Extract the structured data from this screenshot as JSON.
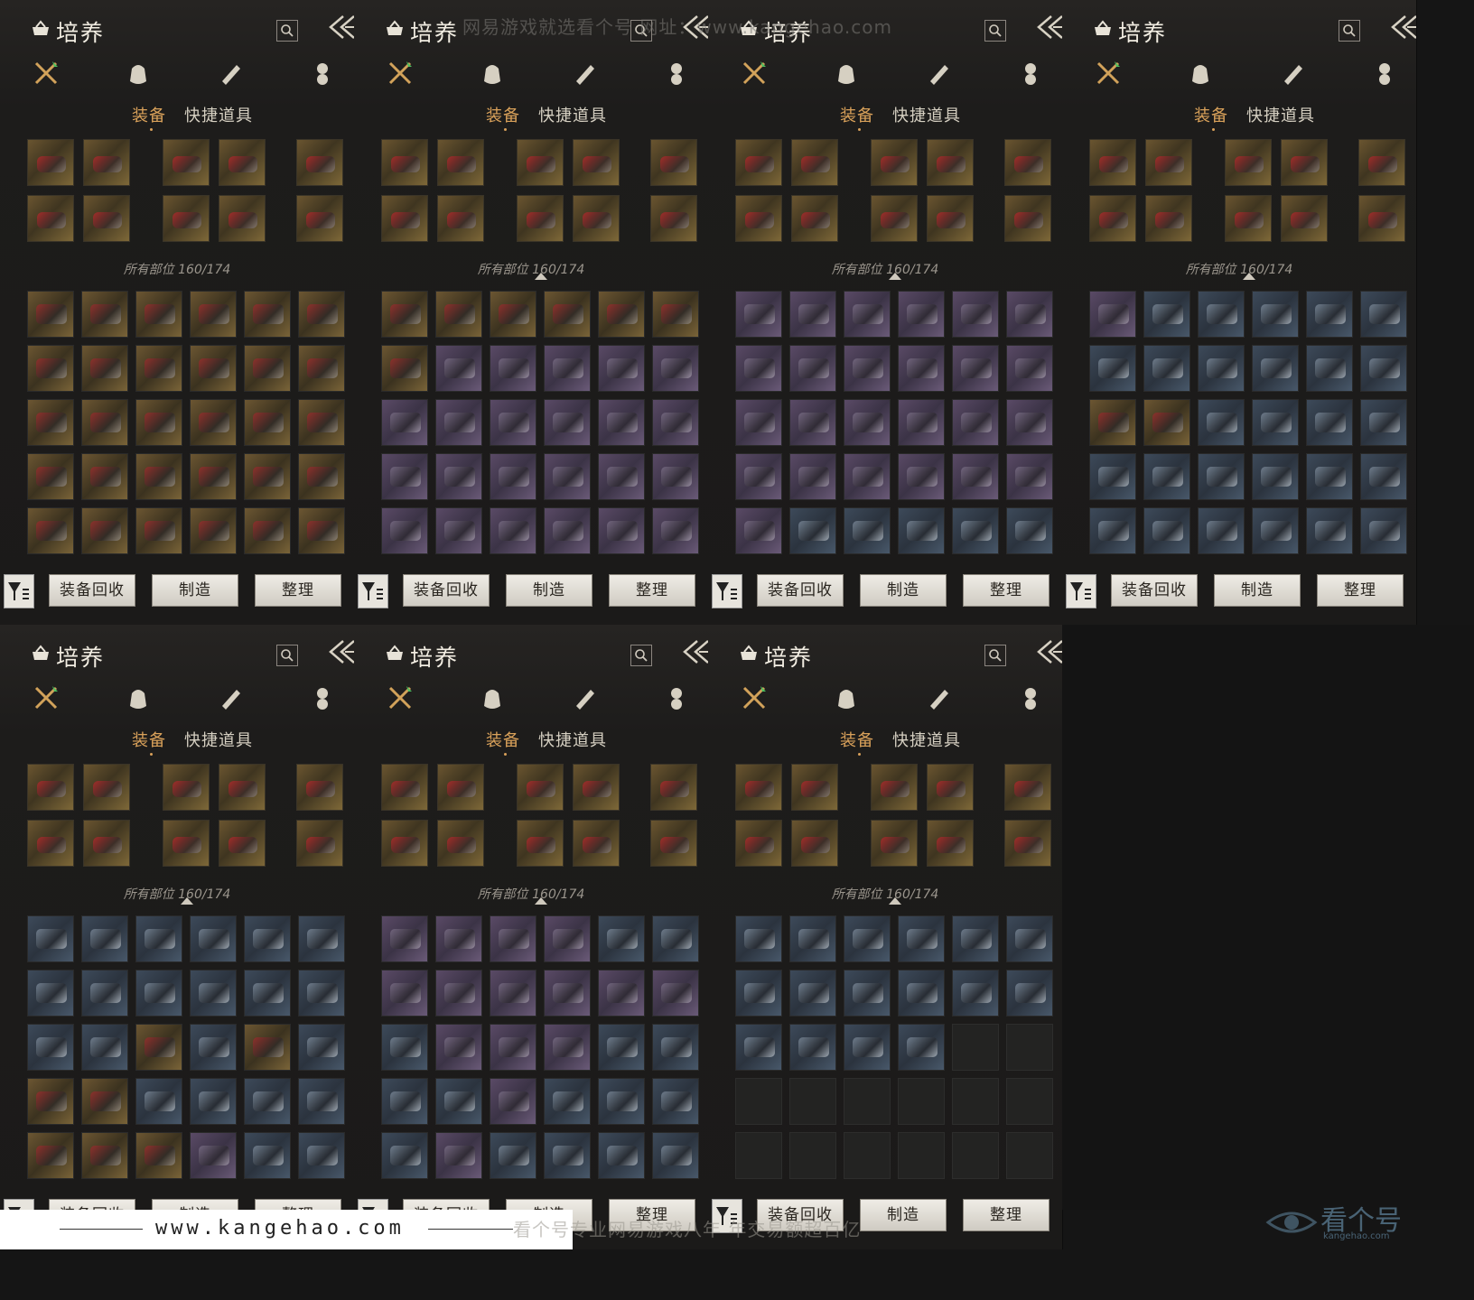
{
  "panel_title": "培养",
  "tabs": {
    "equipment": "装备",
    "quick_items": "快捷道具"
  },
  "slot_count": "所有部位 160/174",
  "buttons": {
    "recycle": "装备回收",
    "craft": "制造",
    "sort": "整理"
  },
  "category_icons": [
    "crossed-swords-icon",
    "pouch-icon",
    "scroll-icon",
    "character-icon"
  ],
  "panels": [
    {
      "grid": [
        "g",
        "g",
        "g",
        "g",
        "g",
        "g",
        "g",
        "g",
        "g",
        "g",
        "g",
        "g",
        "g",
        "g",
        "g",
        "g",
        "g",
        "g",
        "g",
        "g",
        "g",
        "g",
        "g",
        "g",
        "g",
        "g",
        "g",
        "g",
        "g",
        "g"
      ]
    },
    {
      "grid": [
        "g",
        "g",
        "g",
        "g",
        "g",
        "g",
        "g",
        "p",
        "p",
        "p",
        "p",
        "p",
        "p",
        "p",
        "p",
        "p",
        "p",
        "p",
        "p",
        "p",
        "p",
        "p",
        "p",
        "p",
        "p",
        "p",
        "p",
        "p",
        "p",
        "p"
      ]
    },
    {
      "grid": [
        "p",
        "p",
        "p",
        "p",
        "p",
        "p",
        "p",
        "p",
        "p",
        "p",
        "p",
        "p",
        "p",
        "p",
        "p",
        "p",
        "p",
        "p",
        "p",
        "p",
        "p",
        "p",
        "p",
        "p",
        "p",
        "b",
        "b",
        "b",
        "b",
        "b"
      ]
    },
    {
      "grid": [
        "p",
        "b",
        "b",
        "b",
        "b",
        "b",
        "b",
        "b",
        "b",
        "b",
        "b",
        "b",
        "g",
        "g",
        "b",
        "b",
        "b",
        "b",
        "b",
        "b",
        "b",
        "b",
        "b",
        "b",
        "b",
        "b",
        "b",
        "b",
        "b",
        "b"
      ]
    },
    {
      "grid": [
        "b",
        "b",
        "b",
        "b",
        "b",
        "b",
        "b",
        "b",
        "b",
        "b",
        "b",
        "b",
        "b",
        "b",
        "g",
        "b",
        "g",
        "b",
        "g",
        "g",
        "b",
        "b",
        "b",
        "b",
        "g",
        "g",
        "g",
        "p",
        "b",
        "b"
      ]
    },
    {
      "grid": [
        "p",
        "p",
        "p",
        "p",
        "b",
        "b",
        "p",
        "p",
        "p",
        "p",
        "p",
        "p",
        "b",
        "p",
        "p",
        "p",
        "b",
        "b",
        "b",
        "b",
        "p",
        "b",
        "b",
        "b",
        "b",
        "p",
        "b",
        "b",
        "b",
        "b"
      ]
    },
    {
      "grid": [
        "b",
        "b",
        "b",
        "b",
        "b",
        "b",
        "b",
        "b",
        "b",
        "b",
        "b",
        "b",
        "b",
        "b",
        "b",
        "b",
        "e",
        "e",
        "e",
        "e",
        "e",
        "e",
        "e",
        "e",
        "e",
        "e",
        "e",
        "e",
        "e",
        "e"
      ]
    }
  ],
  "watermarks": {
    "top": "网易游戏就选看个号 网址：www.kangehao.com",
    "bottom": "看个号专业网易游戏八年 年交易额超百亿"
  },
  "footer": {
    "url": "www.kangehao.com"
  },
  "logo": {
    "name": "看个号",
    "sub": "kangehao.com"
  }
}
